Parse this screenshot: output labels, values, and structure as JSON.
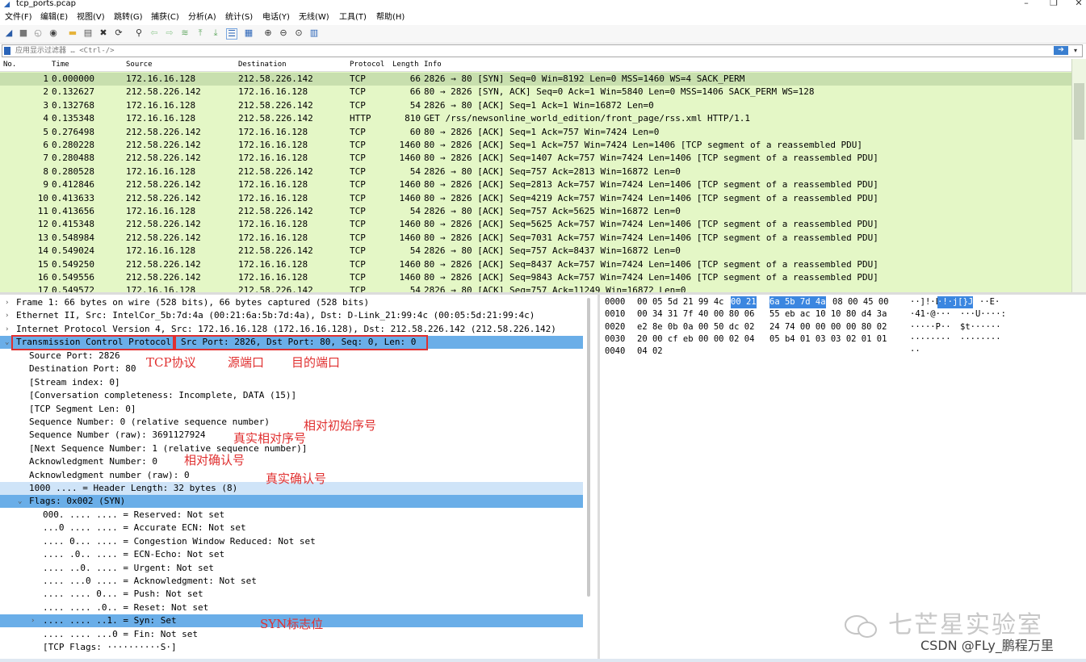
{
  "window": {
    "title": "tcp_ports.pcap",
    "min": "–",
    "max": "❐",
    "close": "✕"
  },
  "menu": [
    "文件(F)",
    "编辑(E)",
    "视图(V)",
    "跳转(G)",
    "捕获(C)",
    "分析(A)",
    "统计(S)",
    "电话(Y)",
    "无线(W)",
    "工具(T)",
    "帮助(H)"
  ],
  "toolbar_icons": [
    "shark-fin-start-icon",
    "stop-icon",
    "restart-icon",
    "options-gear-icon",
    "open-folder-icon",
    "save-file-icon",
    "close-file-icon",
    "reload-icon",
    "find-packet-icon",
    "back-arrow-icon",
    "forward-arrow-icon",
    "goto-packet-icon",
    "first-packet-icon",
    "last-packet-icon",
    "autoscroll-icon",
    "colorize-icon",
    "zoom-in-icon",
    "zoom-out-icon",
    "zoom-reset-icon",
    "resize-columns-icon"
  ],
  "filter": {
    "placeholder": "应用显示过滤器 … <Ctrl-/>",
    "apply_icon": "arrow-right-icon"
  },
  "packet_list": {
    "columns": [
      "No.",
      "Time",
      "Source",
      "Destination",
      "Protocol",
      "Length",
      "Info"
    ],
    "rows": [
      {
        "no": "1",
        "time": "0.000000",
        "src": "172.16.16.128",
        "dst": "212.58.226.142",
        "proto": "TCP",
        "len": "66",
        "info": "2826 → 80 [SYN] Seq=0 Win=8192 Len=0 MSS=1460 WS=4 SACK_PERM"
      },
      {
        "no": "2",
        "time": "0.132627",
        "src": "212.58.226.142",
        "dst": "172.16.16.128",
        "proto": "TCP",
        "len": "66",
        "info": "80 → 2826 [SYN, ACK] Seq=0 Ack=1 Win=5840 Len=0 MSS=1406 SACK_PERM WS=128"
      },
      {
        "no": "3",
        "time": "0.132768",
        "src": "172.16.16.128",
        "dst": "212.58.226.142",
        "proto": "TCP",
        "len": "54",
        "info": "2826 → 80 [ACK] Seq=1 Ack=1 Win=16872 Len=0"
      },
      {
        "no": "4",
        "time": "0.135348",
        "src": "172.16.16.128",
        "dst": "212.58.226.142",
        "proto": "HTTP",
        "len": "810",
        "info": "GET /rss/newsonline_world_edition/front_page/rss.xml HTTP/1.1"
      },
      {
        "no": "5",
        "time": "0.276498",
        "src": "212.58.226.142",
        "dst": "172.16.16.128",
        "proto": "TCP",
        "len": "60",
        "info": "80 → 2826 [ACK] Seq=1 Ack=757 Win=7424 Len=0"
      },
      {
        "no": "6",
        "time": "0.280228",
        "src": "212.58.226.142",
        "dst": "172.16.16.128",
        "proto": "TCP",
        "len": "1460",
        "info": "80 → 2826 [ACK] Seq=1 Ack=757 Win=7424 Len=1406 [TCP segment of a reassembled PDU]"
      },
      {
        "no": "7",
        "time": "0.280488",
        "src": "212.58.226.142",
        "dst": "172.16.16.128",
        "proto": "TCP",
        "len": "1460",
        "info": "80 → 2826 [ACK] Seq=1407 Ack=757 Win=7424 Len=1406 [TCP segment of a reassembled PDU]"
      },
      {
        "no": "8",
        "time": "0.280528",
        "src": "172.16.16.128",
        "dst": "212.58.226.142",
        "proto": "TCP",
        "len": "54",
        "info": "2826 → 80 [ACK] Seq=757 Ack=2813 Win=16872 Len=0"
      },
      {
        "no": "9",
        "time": "0.412846",
        "src": "212.58.226.142",
        "dst": "172.16.16.128",
        "proto": "TCP",
        "len": "1460",
        "info": "80 → 2826 [ACK] Seq=2813 Ack=757 Win=7424 Len=1406 [TCP segment of a reassembled PDU]"
      },
      {
        "no": "10",
        "time": "0.413633",
        "src": "212.58.226.142",
        "dst": "172.16.16.128",
        "proto": "TCP",
        "len": "1460",
        "info": "80 → 2826 [ACK] Seq=4219 Ack=757 Win=7424 Len=1406 [TCP segment of a reassembled PDU]"
      },
      {
        "no": "11",
        "time": "0.413656",
        "src": "172.16.16.128",
        "dst": "212.58.226.142",
        "proto": "TCP",
        "len": "54",
        "info": "2826 → 80 [ACK] Seq=757 Ack=5625 Win=16872 Len=0"
      },
      {
        "no": "12",
        "time": "0.415348",
        "src": "212.58.226.142",
        "dst": "172.16.16.128",
        "proto": "TCP",
        "len": "1460",
        "info": "80 → 2826 [ACK] Seq=5625 Ack=757 Win=7424 Len=1406 [TCP segment of a reassembled PDU]"
      },
      {
        "no": "13",
        "time": "0.548984",
        "src": "212.58.226.142",
        "dst": "172.16.16.128",
        "proto": "TCP",
        "len": "1460",
        "info": "80 → 2826 [ACK] Seq=7031 Ack=757 Win=7424 Len=1406 [TCP segment of a reassembled PDU]"
      },
      {
        "no": "14",
        "time": "0.549024",
        "src": "172.16.16.128",
        "dst": "212.58.226.142",
        "proto": "TCP",
        "len": "54",
        "info": "2826 → 80 [ACK] Seq=757 Ack=8437 Win=16872 Len=0"
      },
      {
        "no": "15",
        "time": "0.549250",
        "src": "212.58.226.142",
        "dst": "172.16.16.128",
        "proto": "TCP",
        "len": "1460",
        "info": "80 → 2826 [ACK] Seq=8437 Ack=757 Win=7424 Len=1406 [TCP segment of a reassembled PDU]"
      },
      {
        "no": "16",
        "time": "0.549556",
        "src": "212.58.226.142",
        "dst": "172.16.16.128",
        "proto": "TCP",
        "len": "1460",
        "info": "80 → 2826 [ACK] Seq=9843 Ack=757 Win=7424 Len=1406 [TCP segment of a reassembled PDU]"
      },
      {
        "no": "17",
        "time": "0.549572",
        "src": "172.16.16.128",
        "dst": "212.58.226.142",
        "proto": "TCP",
        "len": "54",
        "info": "2826 → 80 [ACK] Seq=757 Ack=11249 Win=16872 Len=0"
      }
    ]
  },
  "details": {
    "frame": "Frame 1: 66 bytes on wire (528 bits), 66 bytes captured (528 bits)",
    "ethernet": "Ethernet II, Src: IntelCor_5b:7d:4a (00:21:6a:5b:7d:4a), Dst: D-Link_21:99:4c (00:05:5d:21:99:4c)",
    "ip": "Internet Protocol Version 4, Src: 172.16.16.128 (172.16.16.128), Dst: 212.58.226.142 (212.58.226.142)",
    "tcp_a": "Transmission Control Protocol",
    "tcp_b": "Src Port: 2826, Dst Port: 80, Seq: 0, Len: 0",
    "lines": [
      "Source Port: 2826",
      "Destination Port: 80",
      "[Stream index: 0]",
      "[Conversation completeness: Incomplete, DATA (15)]",
      "[TCP Segment Len: 0]",
      "Sequence Number: 0    (relative sequence number)",
      "Sequence Number (raw): 3691127924",
      "[Next Sequence Number: 1    (relative sequence number)]",
      "Acknowledgment Number: 0",
      "Acknowledgment number (raw): 0",
      "1000 .... = Header Length: 32 bytes (8)"
    ],
    "flags_header": "Flags: 0x002 (SYN)",
    "flags": [
      "000. .... .... = Reserved: Not set",
      "...0 .... .... = Accurate ECN: Not set",
      ".... 0... .... = Congestion Window Reduced: Not set",
      ".... .0.. .... = ECN-Echo: Not set",
      ".... ..0. .... = Urgent: Not set",
      ".... ...0 .... = Acknowledgment: Not set",
      ".... .... 0... = Push: Not set",
      ".... .... .0.. = Reset: Not set",
      ".... .... ..1. = Syn: Set",
      ".... .... ...0 = Fin: Not set",
      "[TCP Flags: ··········S·]"
    ]
  },
  "annotations": {
    "tcp": "TCP协议",
    "src_port": "源端口",
    "dst_port": "目的端口",
    "rel_seq": "相对初始序号",
    "raw_seq": "真实相对序号",
    "rel_ack": "相对确认号",
    "raw_ack": "真实确认号",
    "syn": "SYN标志位"
  },
  "bytes": {
    "offsets": [
      "0000",
      "0010",
      "0020",
      "0030",
      "0040"
    ],
    "hex_a": [
      "00 05 5d 21 99 4c",
      "00 34 31 7f 40 00 80 06",
      "e2 8e 0b 0a 00 50 dc 02",
      "20 00 cf eb 00 00 02 04",
      "04 02"
    ],
    "hex_sel_a": "00 21",
    "hex_b": [
      "6a 5b 7d 4a",
      "55 eb ac 10 10 80 d4 3a",
      "24 74 00 00 00 00 80 02",
      "05 b4 01 03 03 02 01 01",
      ""
    ],
    "hex_c": [
      "08 00 45 00",
      "",
      "",
      "",
      ""
    ],
    "ascii_a": [
      "··]!·L",
      "·41·@···",
      "·····P··",
      "········",
      "··"
    ],
    "ascii_sel": "·!·j[}J",
    "ascii_b": [
      "··E·",
      "···U····:",
      "$t······",
      "········",
      ""
    ]
  },
  "watermark": {
    "brand": "七芒星实验室",
    "csdn": "CSDN @FLy_鹏程万里"
  }
}
